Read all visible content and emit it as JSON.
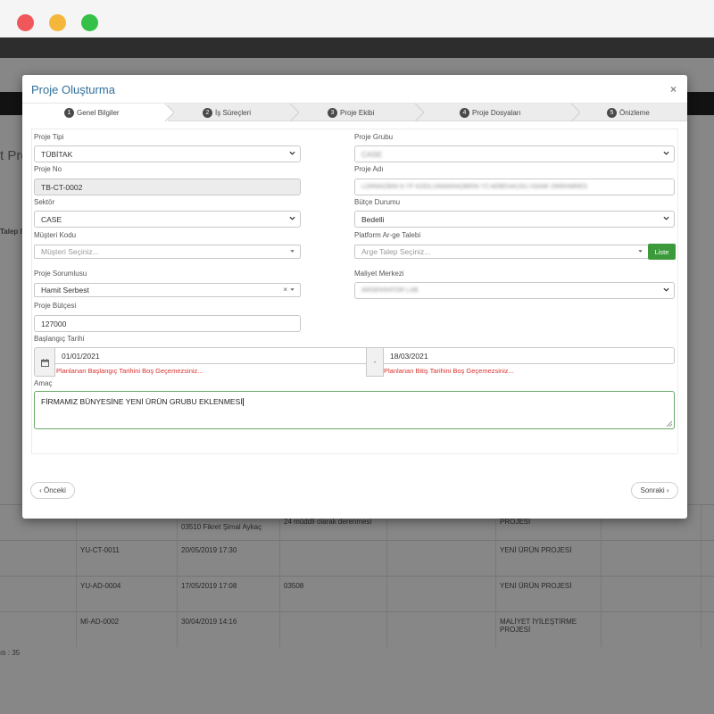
{
  "modal": {
    "title": "Proje Oluşturma",
    "close": "×"
  },
  "steps": [
    {
      "num": "1",
      "label": "Genel Bilgiler"
    },
    {
      "num": "2",
      "label": "İş Süreçleri"
    },
    {
      "num": "3",
      "label": "Proje Ekibi"
    },
    {
      "num": "4",
      "label": "Proje Dosyaları"
    },
    {
      "num": "5",
      "label": "Önizleme"
    }
  ],
  "form": {
    "proje_tipi": {
      "label": "Proje Tipi",
      "value": "TÜBİTAK"
    },
    "proje_grubu": {
      "label": "Proje Grubu",
      "value": "CASE"
    },
    "proje_no": {
      "label": "Proje No",
      "value": "TB-CT-0002"
    },
    "proje_adi": {
      "label": "Proje Adı",
      "value": "LORMAZBIN N YF KODLUNMARADBRIN YZ AEBEHAUSU ISANK ORRHMRES"
    },
    "sektor": {
      "label": "Sektör",
      "value": "CASE"
    },
    "butce_durumu": {
      "label": "Bütçe Durumu",
      "value": "Bedelli"
    },
    "musteri_kodu": {
      "label": "Müşteri Kodu",
      "placeholder": "Müşteri Seçiniz..."
    },
    "platform": {
      "label": "Platform Ar-ge Talebi",
      "placeholder": "Arge Talep Seçiniz...",
      "button": "Liste"
    },
    "sorumlu": {
      "label": "Proje Sorumlusu",
      "value": "Hamit Serbest",
      "clear": "×"
    },
    "maliyet": {
      "label": "Maliyet Merkezi",
      "value": "ARGEKRATOR LAB"
    },
    "butce": {
      "label": "Proje Bütçesi",
      "value": "127000"
    },
    "tarih": {
      "label": "Başlangıç Tarihi",
      "start": "01/01/2021",
      "end": "18/03/2021",
      "separator": "-",
      "start_error": "Planlanan Başlangıç Tarihini Boş Geçemezsiniz...",
      "end_error": "Planlanan Bitiş Tarihini Boş Geçemezsiniz..."
    },
    "amac": {
      "label": "Amaç",
      "value": "FİRMAMIZ BÜNYESİNE YENİ ÜRÜN GRUBU EKLENMESİ"
    }
  },
  "nav": {
    "prev": "‹ Önceki",
    "next": "Sonraki ›"
  },
  "background": {
    "page_title": "t Pro",
    "col_header": "Talep I",
    "rows": [
      {
        "code": "",
        "date": "03510 Fikret Şimal Aykaç",
        "desc": "24 müddli olarak derenmesi",
        "type": "PROJESİ"
      },
      {
        "code": "YU-CT-0011",
        "date": "20/05/2019 17:30",
        "desc": "",
        "type": "YENİ ÜRÜN PROJESİ"
      },
      {
        "code": "YU-AD-0004",
        "date": "17/05/2019 17:08",
        "desc": "03508",
        "type": "YENİ ÜRÜN PROJESİ"
      },
      {
        "code": "Mİ-AD-0002",
        "date": "30/04/2019 14:16",
        "desc": "",
        "type": "MALİYET İYİLEŞTİRME PROJESİ"
      }
    ],
    "footer": "ıtı : 35"
  }
}
